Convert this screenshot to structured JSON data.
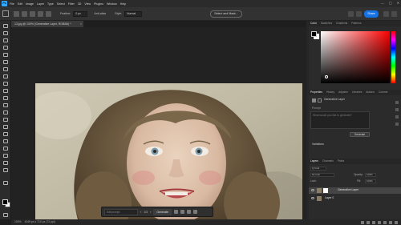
{
  "app": {
    "logo": "Ps",
    "menu": [
      "File",
      "Edit",
      "Image",
      "Layer",
      "Type",
      "Select",
      "Filter",
      "3D",
      "View",
      "Plugins",
      "Window",
      "Help"
    ],
    "window_controls": [
      "—",
      "▢",
      "✕"
    ]
  },
  "options_bar": {
    "feather_label": "Feather:",
    "feather_value": "0 px",
    "antialias_label": "Anti-alias",
    "style_label": "Style:",
    "style_value": "Normal",
    "select_mask_label": "Select and Mask...",
    "share_label": "Share"
  },
  "document": {
    "tab_title": "13.jpg @ 100% (Generative Layer, RGB/8#) *",
    "close": "×",
    "status": "100%",
    "status_size": "1049 px x 710 px (72 ppi)"
  },
  "taskbar": {
    "prompt_placeholder": "Edit prompt",
    "variation_count": "1/3",
    "generate_label": "Generate"
  },
  "panels": {
    "color_tabs": [
      "Color",
      "Swatches",
      "Gradients",
      "Patterns"
    ],
    "properties_tabs": [
      "Properties",
      "History",
      "Adjustm",
      "Libraries",
      "Actions",
      "Comme"
    ],
    "properties_title": "Generative Layer",
    "prompt_caption": "Prompt",
    "prompt_placeholder": "What would you like to generate?",
    "generate_label": "Generate",
    "variations_label": "Variations",
    "layers_tabs": [
      "Layers",
      "Channels",
      "Paths"
    ],
    "kind_label": "Q Kind",
    "blend_mode": "Normal",
    "opacity_label": "Opacity:",
    "opacity_value": "100%",
    "lock_label": "Lock:",
    "fill_label": "Fill:",
    "fill_value": "100%",
    "layers": [
      {
        "name": "Generative Layer",
        "selected": true
      },
      {
        "name": "Layer 0",
        "selected": false
      }
    ]
  },
  "colors": {
    "accent": "#31a8ff",
    "share": "#1473e6",
    "panel": "#2b2b2b"
  }
}
